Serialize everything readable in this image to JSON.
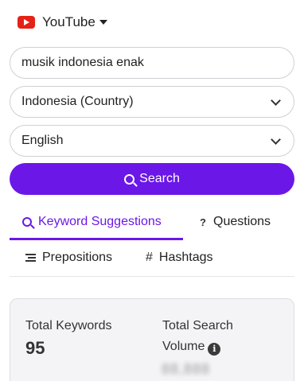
{
  "platform": {
    "label": "YouTube",
    "icon": "youtube-logo-icon",
    "brand_color": "#e62117"
  },
  "search": {
    "query": "musik indonesia enak"
  },
  "country_select": {
    "value": "Indonesia (Country)"
  },
  "language_select": {
    "value": "English"
  },
  "search_button": {
    "label": "Search",
    "color": "#6b17e8"
  },
  "tabs": [
    {
      "label": "Keyword Suggestions",
      "icon": "search-icon",
      "active": true
    },
    {
      "label": "Questions",
      "icon": "question-icon"
    },
    {
      "label": "Prepositions",
      "icon": "indent-list-icon"
    },
    {
      "label": "Hashtags",
      "icon": "hash-icon"
    }
  ],
  "stats": {
    "total_keywords_label": "Total Keywords",
    "total_keywords_value": "95",
    "total_search_volume_label_line1": "Total Search",
    "total_search_volume_label_line2": "Volume",
    "total_search_volume_value": "88,888"
  }
}
